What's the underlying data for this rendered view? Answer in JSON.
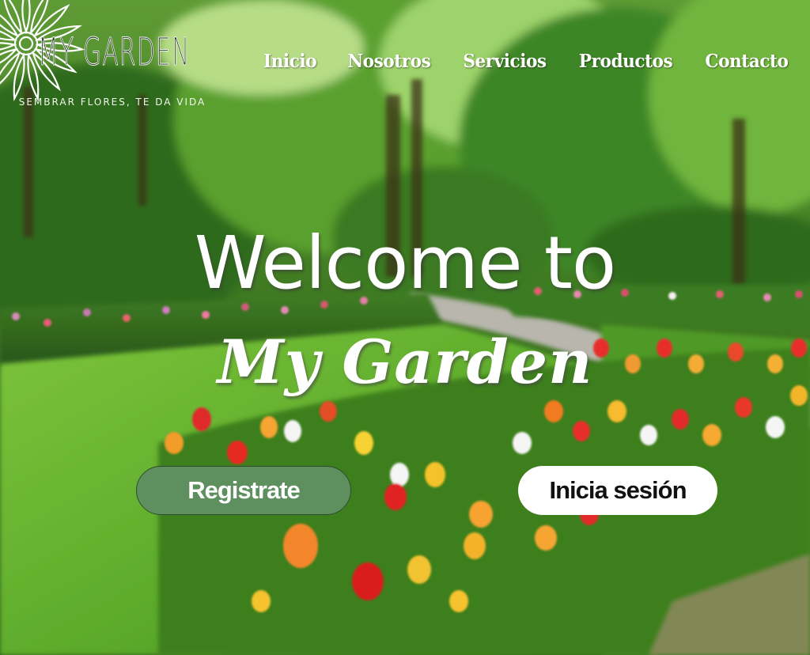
{
  "logo": {
    "brand": "MY GARDEN",
    "tagline": "SEMBRAR FLORES, TE DA VIDA"
  },
  "nav": {
    "items": [
      {
        "label": "Inicio"
      },
      {
        "label": "Nosotros"
      },
      {
        "label": "Servicios"
      },
      {
        "label": "Productos"
      },
      {
        "label": "Contacto"
      }
    ]
  },
  "hero": {
    "title": "Welcome to",
    "subtitle": "My Garden"
  },
  "buttons": {
    "register_label": "Registrate",
    "login_label": "Inicia sesión"
  },
  "colors": {
    "register_button": "#5e8f5e",
    "login_button": "#ffffff",
    "nav_text": "#ffffff"
  }
}
